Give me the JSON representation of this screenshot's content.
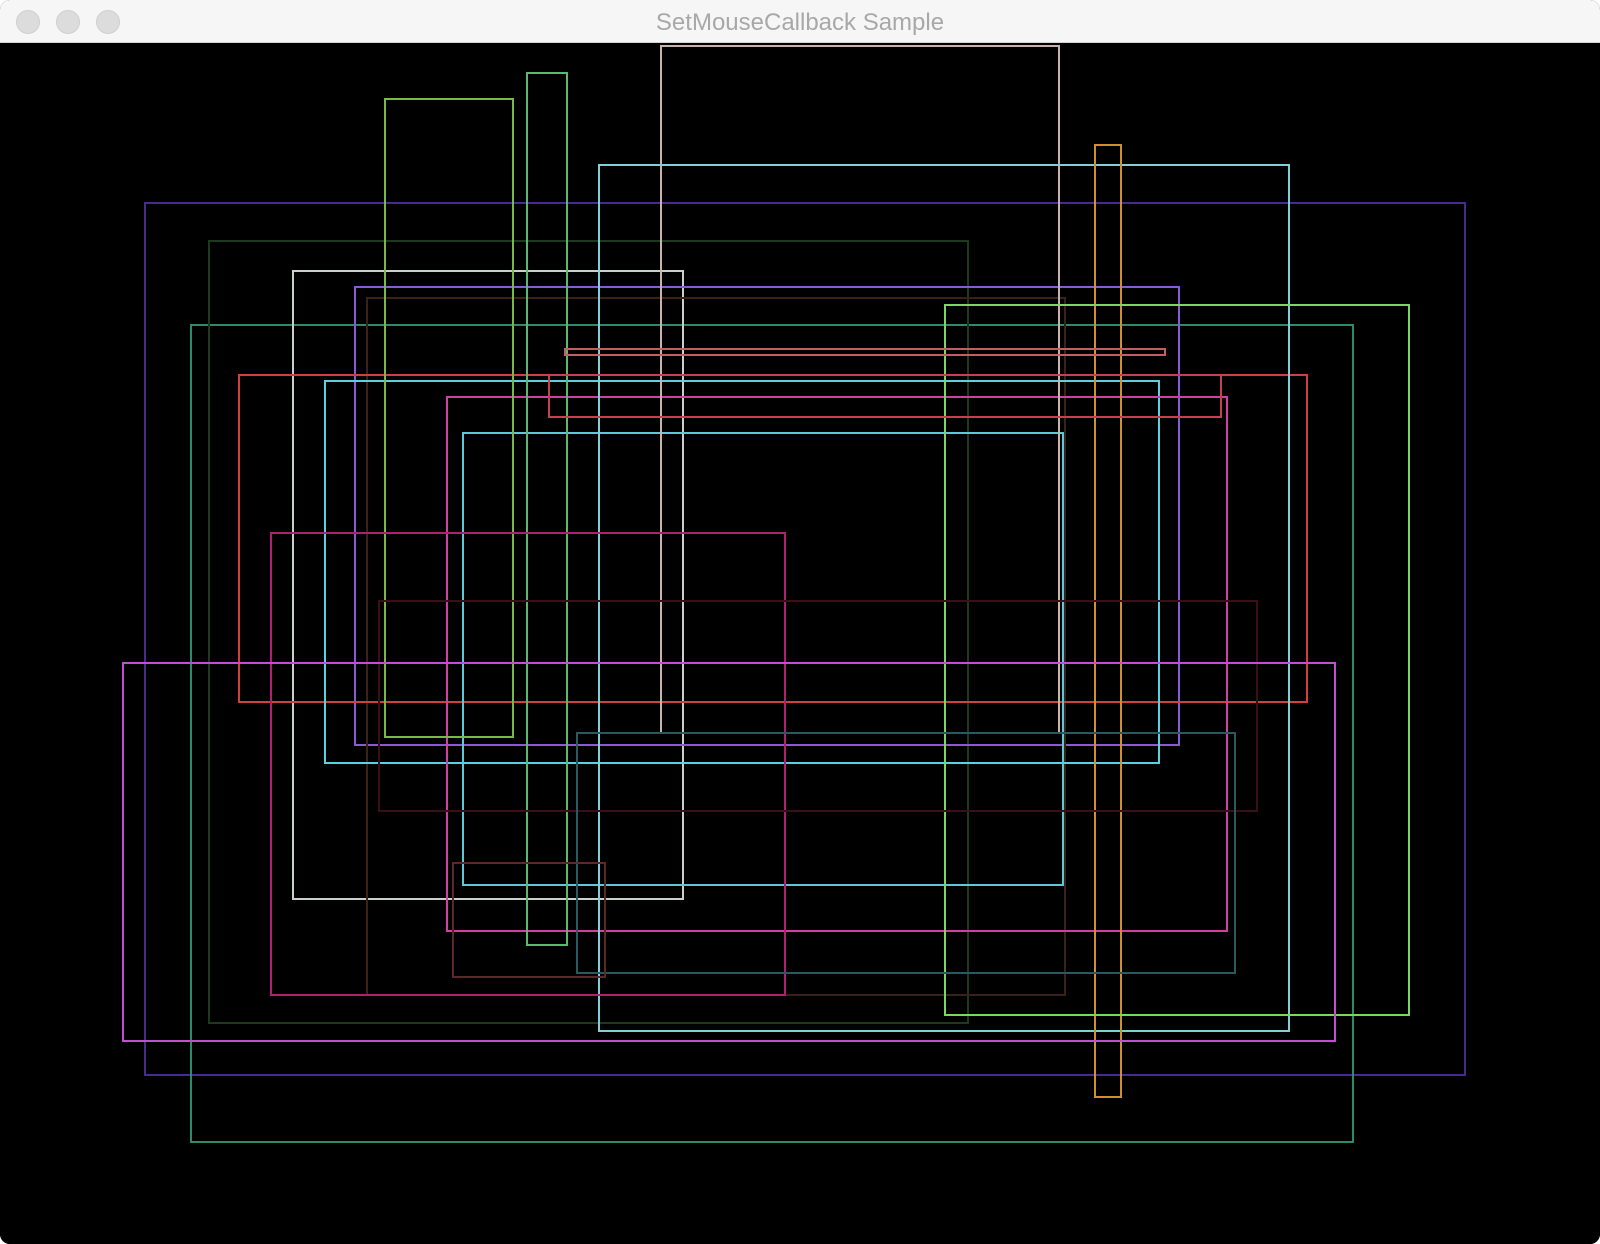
{
  "window": {
    "title": "SetMouseCallback Sample",
    "buttons": {
      "close": "close-button",
      "minimize": "minimize-button",
      "zoom": "zoom-button"
    },
    "background": "#000000"
  },
  "rectangle_colors": [
    "#4a2a8c",
    "#2a8c6a",
    "#1e3a1e",
    "#c8d0c8",
    "#8a5ad6",
    "#3a2218",
    "#d04040",
    "#5ad0e0",
    "#d040a0",
    "#5cc8d8",
    "#7ab84a",
    "#5ab870",
    "#c8b4aa",
    "#80d0d8",
    "#d09030",
    "#7ad860",
    "#c84050",
    "#c06060",
    "#b02070",
    "#3a1018",
    "#c050d0",
    "#2a5a60",
    "#5a2a2a"
  ]
}
